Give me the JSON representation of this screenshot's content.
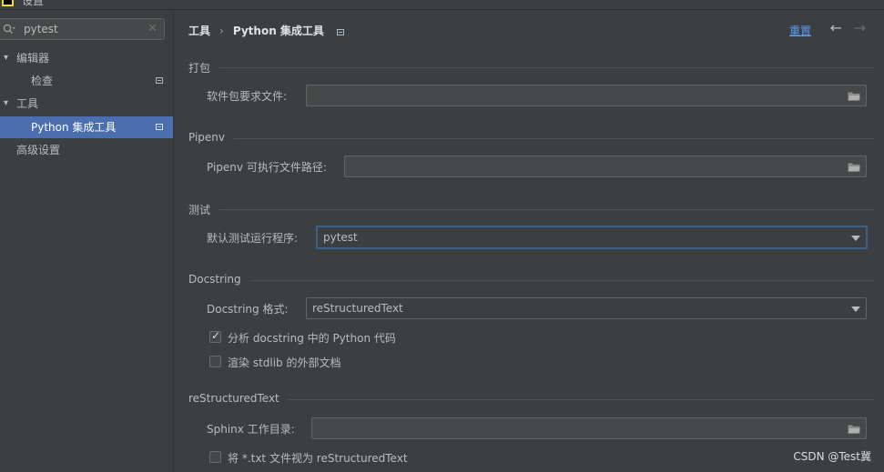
{
  "window": {
    "title": "设置"
  },
  "colors": {
    "background": "#3c3f41",
    "selection": "#4b6eaf",
    "link": "#589df6",
    "focus": "#3d6185"
  },
  "search": {
    "value": "pytest",
    "icon": "search-icon",
    "clear_icon": "close-icon"
  },
  "sidebar": {
    "items": [
      {
        "label": "编辑器",
        "level": 0,
        "expanded": true
      },
      {
        "label": "检查",
        "level": 1
      },
      {
        "label": "工具",
        "level": 0,
        "expanded": true
      },
      {
        "label": "Python 集成工具",
        "level": 1,
        "selected": true
      },
      {
        "label": "高级设置",
        "level": 0
      }
    ]
  },
  "header": {
    "breadcrumb_parent": "工具",
    "breadcrumb_separator": "›",
    "breadcrumb_current": "Python 集成工具",
    "reset": "重置",
    "back_icon": "arrow-left-icon",
    "forward_icon": "arrow-right-icon"
  },
  "sections": {
    "packaging": {
      "title": "打包",
      "requirements_label": "软件包要求文件:",
      "requirements_value": ""
    },
    "pipenv": {
      "title": "Pipenv",
      "path_label": "Pipenv 可执行文件路径:",
      "path_value": ""
    },
    "testing": {
      "title": "测试",
      "runner_label": "默认测试运行程序:",
      "runner_value": "pytest"
    },
    "docstring": {
      "title": "Docstring",
      "format_label": "Docstring 格式:",
      "format_value": "reStructuredText",
      "analyze_label": "分析 docstring 中的 Python 代码",
      "analyze_checked": true,
      "render_label": "渲染 stdlib 的外部文档",
      "render_checked": false
    },
    "rest": {
      "title": "reStructuredText",
      "sphinx_label": "Sphinx 工作目录:",
      "sphinx_value": "",
      "treat_txt_label": "将 *.txt 文件视为 reStructuredText",
      "treat_txt_checked": false
    }
  },
  "watermark": "CSDN @Test冀"
}
